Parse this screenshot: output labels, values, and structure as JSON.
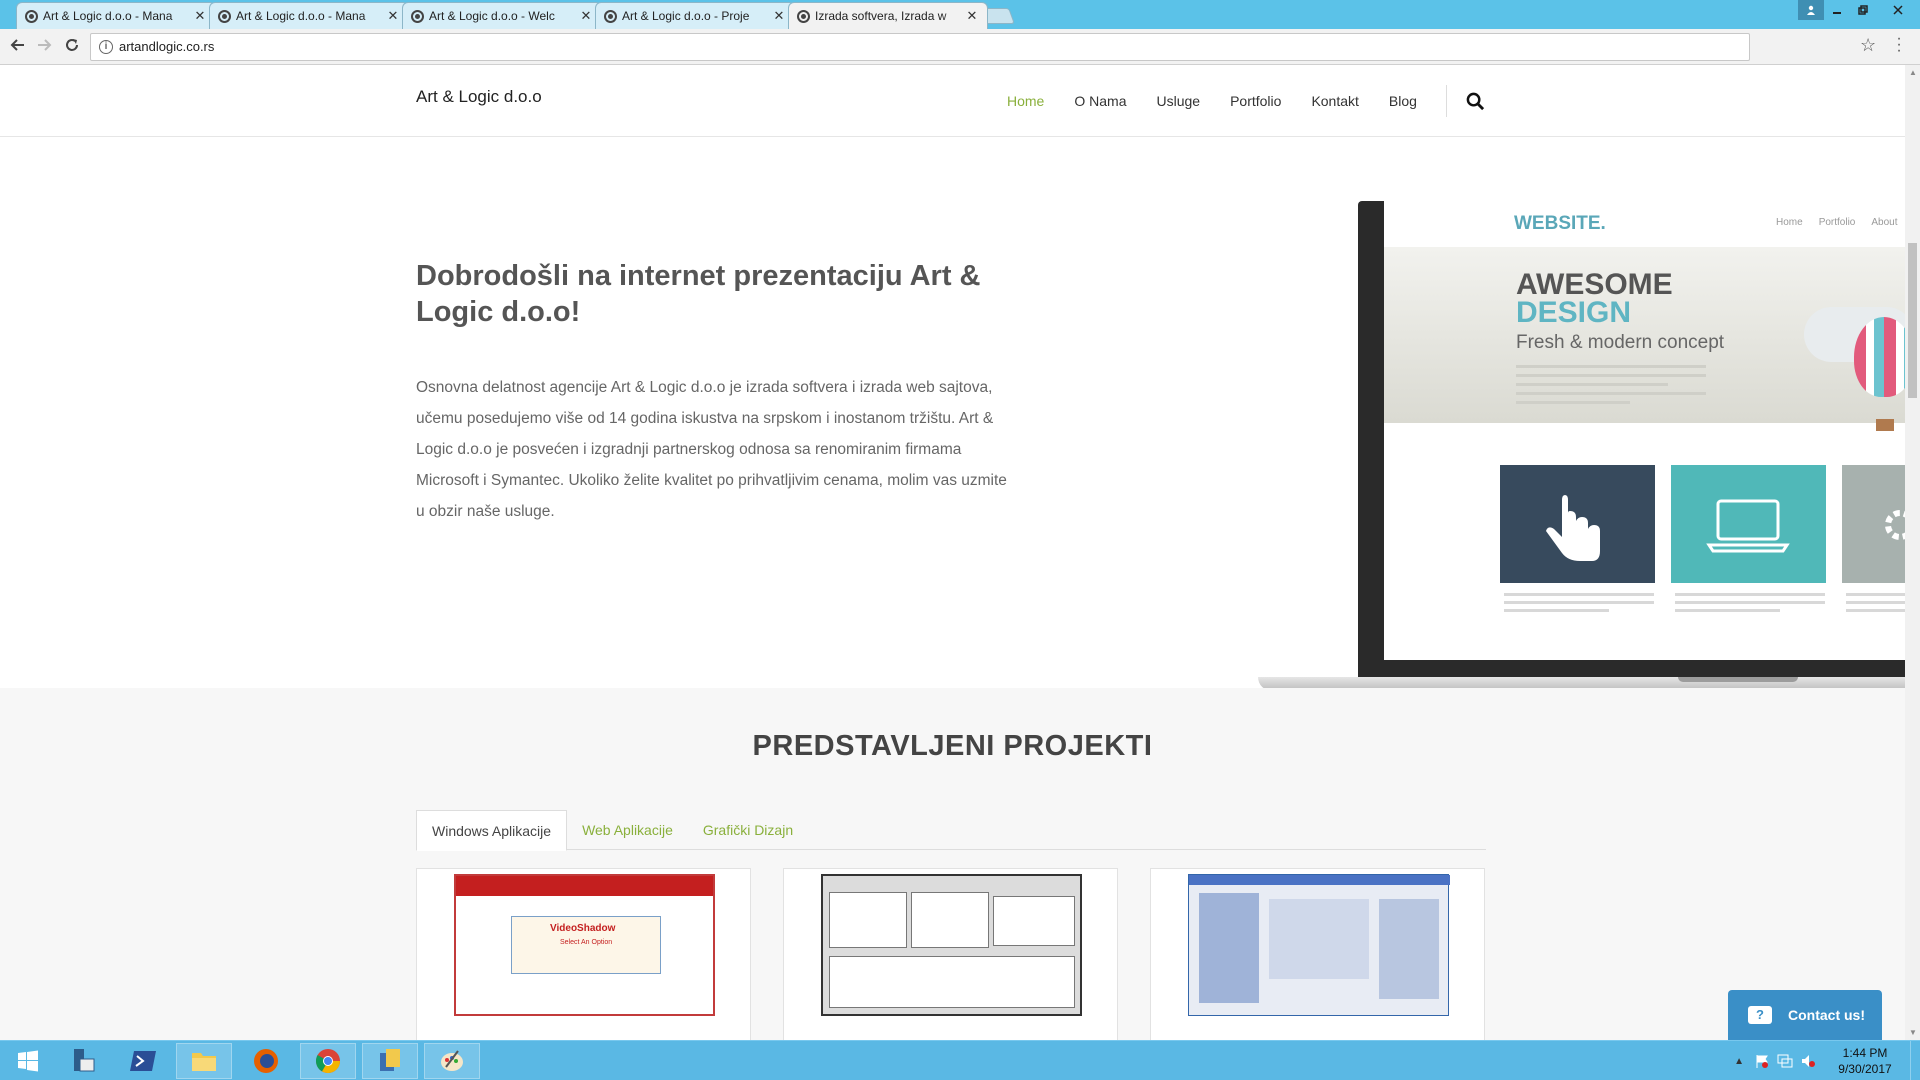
{
  "browser": {
    "tabs": [
      {
        "title": "Art & Logic d.o.o - Mana"
      },
      {
        "title": "Art & Logic d.o.o - Mana"
      },
      {
        "title": "Art & Logic d.o.o - Welc"
      },
      {
        "title": "Art & Logic d.o.o - Proje"
      },
      {
        "title": "Izrada softvera, Izrada w"
      }
    ],
    "address": "artandlogic.co.rs",
    "close_glyph": "✕"
  },
  "site": {
    "brand": "Art & Logic d.o.o",
    "nav": [
      "Home",
      "O Nama",
      "Usluge",
      "Portfolio",
      "Kontakt",
      "Blog"
    ],
    "hero_title": "Dobrodošli na internet prezentaciju Art & Logic d.o.o!",
    "hero_text": "Osnovna delatnost agencije Art & Logic d.o.o je izrada softvera i izrada web sajtova, učemu posedujemo više od 14 godina iskustva na srpskom i inostanom tržištu. Art & Logic d.o.o je posvećen i izgradnji partnerskog odnosa sa renomiranim firmama Microsoft i Symantec. Ukoliko želite kvalitet po prihvatljivim cenama, molim vas uzmite u obzir naše usluge.",
    "mockup": {
      "logo": "WEBSITE.",
      "nav": [
        "Home",
        "Portfolio",
        "About"
      ],
      "headline_1": "AWESOME",
      "headline_2": "DESIGN",
      "subhead": "Fresh & modern concept"
    },
    "projects_title": "PREDSTAVLJENI PROJEKTI",
    "project_tabs": [
      "Windows Aplikacije",
      "Web Aplikacije",
      "Grafički Dizajn"
    ],
    "videoshadow_title": "VideoShadow",
    "videoshadow_sub": "Select An Option",
    "contact_label": "Contact us!"
  },
  "taskbar": {
    "time": "1:44 PM",
    "date": "9/30/2017"
  },
  "colors": {
    "accent_green": "#8ab03c",
    "chrome_blue": "#5bc2e8",
    "contact_blue": "#3a8fc7"
  }
}
